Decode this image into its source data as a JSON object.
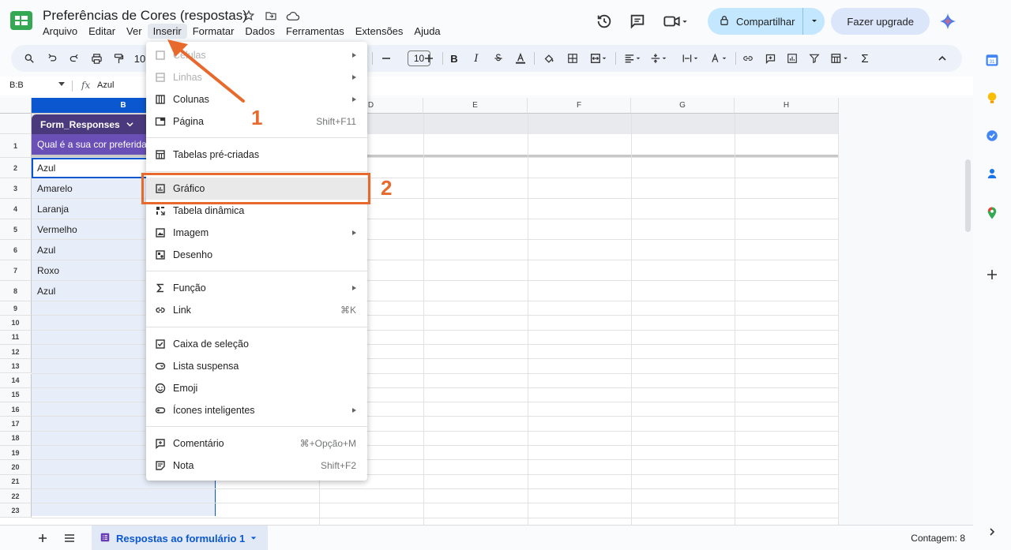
{
  "doc": {
    "title": "Preferências de Cores (respostas)"
  },
  "menubar": [
    "Arquivo",
    "Editar",
    "Ver",
    "Inserir",
    "Formatar",
    "Dados",
    "Ferramentas",
    "Extensões",
    "Ajuda"
  ],
  "header": {
    "share_label": "Compartilhar",
    "upgrade_label": "Fazer upgrade"
  },
  "toolbar": {
    "zoom": "10",
    "font_size": "10"
  },
  "formula": {
    "namebox": "B:B",
    "fx": "fx",
    "value": "Azul"
  },
  "grid": {
    "columns": [
      "B",
      "D",
      "E",
      "F",
      "G",
      "H"
    ],
    "rows": [
      "1",
      "2",
      "3",
      "4",
      "5",
      "6",
      "7",
      "8",
      "9",
      "10",
      "11",
      "12",
      "13",
      "14",
      "15",
      "16",
      "17",
      "18",
      "19",
      "20",
      "21",
      "22",
      "23"
    ],
    "table_name": "Form_Responses",
    "header_cell": "Qual é a sua cor preferida?",
    "cells": [
      "Azul",
      "Amarelo",
      "Laranja",
      "Vermelho",
      "Azul",
      "Roxo",
      "Azul"
    ]
  },
  "menu": {
    "items": [
      {
        "label": "Células",
        "icon": "cells-icon",
        "disabled": true,
        "submenu": true,
        "shortcut": ""
      },
      {
        "label": "Linhas",
        "icon": "rows-icon",
        "disabled": true,
        "submenu": true,
        "shortcut": ""
      },
      {
        "label": "Colunas",
        "icon": "columns-icon",
        "disabled": false,
        "submenu": true,
        "shortcut": ""
      },
      {
        "label": "Página",
        "icon": "page-icon",
        "disabled": false,
        "submenu": false,
        "shortcut": "Shift+F11"
      },
      {
        "label": "Tabelas pré-criadas",
        "icon": "table-icon",
        "disabled": false,
        "submenu": false,
        "shortcut": ""
      },
      {
        "label": "Gráfico",
        "icon": "chart-icon",
        "disabled": false,
        "submenu": false,
        "shortcut": "",
        "highlighted": true
      },
      {
        "label": "Tabela dinâmica",
        "icon": "pivot-table-icon",
        "disabled": false,
        "submenu": false,
        "shortcut": ""
      },
      {
        "label": "Imagem",
        "icon": "image-icon",
        "disabled": false,
        "submenu": true,
        "shortcut": ""
      },
      {
        "label": "Desenho",
        "icon": "drawing-icon",
        "disabled": false,
        "submenu": false,
        "shortcut": ""
      },
      {
        "label": "Função",
        "icon": "sigma-icon",
        "disabled": false,
        "submenu": true,
        "shortcut": ""
      },
      {
        "label": "Link",
        "icon": "link-icon",
        "disabled": false,
        "submenu": false,
        "shortcut": "⌘K"
      },
      {
        "label": "Caixa de seleção",
        "icon": "checkbox-icon",
        "disabled": false,
        "submenu": false,
        "shortcut": ""
      },
      {
        "label": "Lista suspensa",
        "icon": "dropdown-list-icon",
        "disabled": false,
        "submenu": false,
        "shortcut": ""
      },
      {
        "label": "Emoji",
        "icon": "emoji-icon",
        "disabled": false,
        "submenu": false,
        "shortcut": ""
      },
      {
        "label": "Ícones inteligentes",
        "icon": "smart-chips-icon",
        "disabled": false,
        "submenu": true,
        "shortcut": ""
      },
      {
        "label": "Comentário",
        "icon": "comment-icon",
        "disabled": false,
        "submenu": false,
        "shortcut": "⌘+Opção+M"
      },
      {
        "label": "Nota",
        "icon": "note-icon",
        "disabled": false,
        "submenu": false,
        "shortcut": "Shift+F2"
      }
    ]
  },
  "annotations": {
    "step1": "1",
    "step2": "2"
  },
  "bottom": {
    "sheet_tab": "Respostas ao formulário 1",
    "count": "Contagem: 8"
  },
  "colors": {
    "accent": "#0b57d0",
    "annotation": "#e8692c",
    "table_header": "#6a4fb6",
    "share_bg": "#c2e7ff"
  }
}
